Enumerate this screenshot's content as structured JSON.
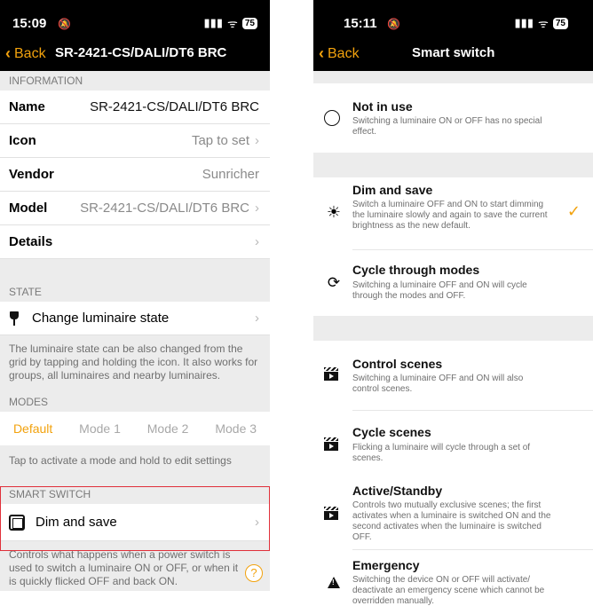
{
  "left": {
    "status": {
      "time": "15:09",
      "signal": "▮▮▮",
      "wifi": "ᯤ",
      "battery": "75"
    },
    "nav": {
      "back_label": "Back",
      "title": "SR-2421-CS/DALI/DT6 BRC"
    },
    "information": {
      "header": "INFORMATION",
      "rows": [
        {
          "label": "Name",
          "value": "SR-2421-CS/DALI/DT6 BRC"
        },
        {
          "label": "Icon",
          "value": "Tap to set"
        },
        {
          "label": "Vendor",
          "value": "Sunricher"
        },
        {
          "label": "Model",
          "value": "SR-2421-CS/DALI/DT6 BRC"
        },
        {
          "label": "Details",
          "value": ""
        }
      ]
    },
    "state": {
      "header": "STATE",
      "item_label": "Change luminaire state",
      "info": "The luminaire state can be also changed from the grid by tapping and holding the icon. It also works for groups, all luminaires and nearby luminaires."
    },
    "modes": {
      "header": "MODES",
      "items": [
        "Default",
        "Mode 1",
        "Mode 2",
        "Mode 3"
      ],
      "info": "Tap to activate a mode and hold to edit settings"
    },
    "smart_switch": {
      "header": "SMART SWITCH",
      "item_label": "Dim and save",
      "info": "Controls what happens when a power switch is used to switch a luminaire ON or OFF, or when it is quickly flicked OFF and back ON."
    },
    "help_label": "?"
  },
  "right": {
    "status": {
      "time": "15:11",
      "signal": "▮▮▮",
      "wifi": "ᯤ",
      "battery": "75"
    },
    "nav": {
      "back_label": "Back",
      "title": "Smart switch"
    },
    "options": [
      {
        "title": "Not in use",
        "desc": "Switching a luminaire ON or OFF has no special effect.",
        "icon": "empty-circle-icon"
      },
      {
        "title": "Dim and save",
        "desc": "Switch a luminaire OFF and ON to start dimming the luminaire slowly and again to save the current brightness as the new default.",
        "icon": "brightness-icon",
        "selected": true
      },
      {
        "title": "Cycle through modes",
        "desc": "Switching a luminaire OFF and ON will cycle through the modes and OFF.",
        "icon": "cycle-icon"
      },
      {
        "title": "Control scenes",
        "desc": "Switching a luminaire OFF and ON will also control scenes.",
        "icon": "clapperboard-icon"
      },
      {
        "title": "Cycle scenes",
        "desc": "Flicking a luminaire will cycle through a set of scenes.",
        "icon": "clapperboard-icon"
      },
      {
        "title": "Active/Standby",
        "desc": "Controls two mutually exclusive scenes; the first activates when a luminaire is switched ON and the second activates when the luminaire is switched OFF.",
        "icon": "clapperboard-icon"
      },
      {
        "title": "Emergency",
        "desc": "Switching the device ON or OFF will activate/ deactivate an emergency scene which cannot be overridden manually.",
        "icon": "warning-icon"
      }
    ],
    "check_mark": "✓"
  },
  "colors": {
    "accent": "#f2a20d",
    "highlight": "#e0303a",
    "nav_bg": "#000000",
    "group_bg": "#ececec"
  }
}
